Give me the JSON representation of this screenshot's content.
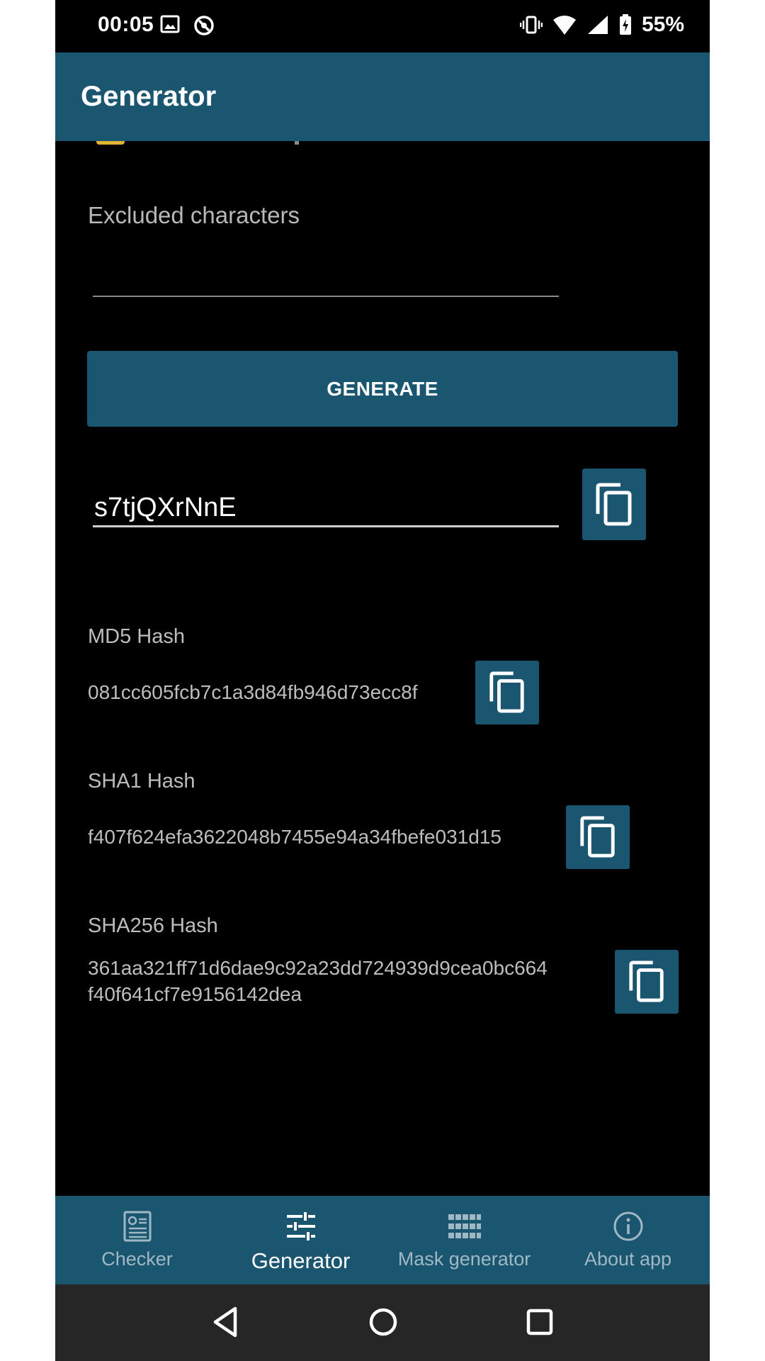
{
  "status_bar": {
    "time": "00:05",
    "battery": "55%",
    "icons": [
      "image-icon",
      "sync-off-icon",
      "vibrate-icon",
      "wifi-icon",
      "signal-icon",
      "battery-icon"
    ]
  },
  "app_bar": {
    "title": "Generator"
  },
  "excluded": {
    "label": "Excluded characters",
    "value": ""
  },
  "generate_button": {
    "label": "GENERATE"
  },
  "password": {
    "value": "s7tjQXrNnE"
  },
  "hashes": {
    "md5": {
      "label": "MD5 Hash",
      "value": "081cc605fcb7c1a3d84fb946d73ecc8f"
    },
    "sha1": {
      "label": "SHA1 Hash",
      "value": "f407f624efa3622048b7455e94a34fbefe031d15"
    },
    "sha256": {
      "label": "SHA256 Hash",
      "value_line1": "361aa321ff71d6dae9c92a23dd724939d9cea0bc664",
      "value_line2": "f40f641cf7e9156142dea"
    }
  },
  "bottom_nav": {
    "items": [
      {
        "label": "Checker",
        "icon": "checker-icon",
        "active": false
      },
      {
        "label": "Generator",
        "icon": "sliders-icon",
        "active": true
      },
      {
        "label": "Mask generator",
        "icon": "grid-icon",
        "active": false
      },
      {
        "label": "About app",
        "icon": "info-icon",
        "active": false
      }
    ]
  },
  "colors": {
    "primary": "#1b5670",
    "background": "#000000",
    "accent_checkbox": "#e0b431"
  }
}
